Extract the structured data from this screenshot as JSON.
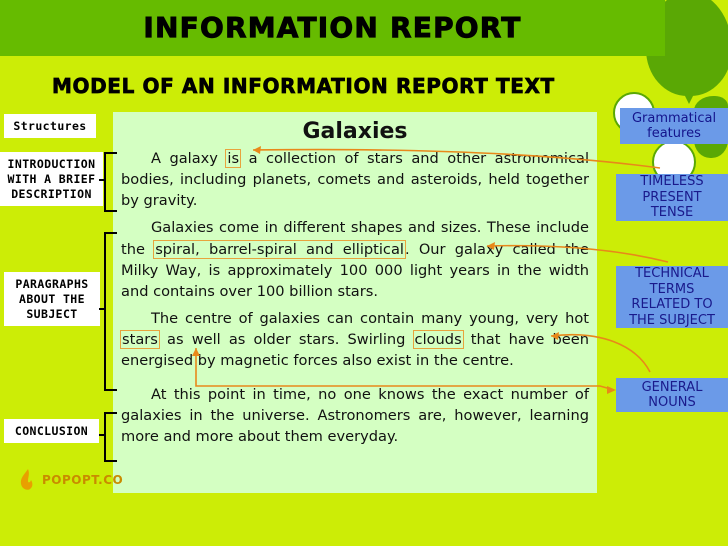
{
  "header": {
    "title": "INFORMATION REPORT",
    "subtitle": "MODEL OF AN INFORMATION REPORT TEXT",
    "band_color": "#66bb00",
    "background_color": "#cced06"
  },
  "content": {
    "title": "Galaxies",
    "card_color": "#d4ffc2",
    "paragraphs": [
      {
        "id": "p1",
        "segments": [
          {
            "text": "A galaxy ",
            "highlight": false
          },
          {
            "text": "is",
            "highlight": true
          },
          {
            "text": " a collection of stars and other astronomical bodies, including planets, comets and asteroids, held together by gravity.",
            "highlight": false
          }
        ]
      },
      {
        "id": "p2",
        "segments": [
          {
            "text": "Galaxies come in different shapes and sizes. These include the ",
            "highlight": false
          },
          {
            "text": "spiral, barrel-spiral and elliptical",
            "highlight": true
          },
          {
            "text": ". Our galaxy called the Milky Way, is approximately 100 000 light years in the width and contains over 100 billion stars.",
            "highlight": false
          }
        ]
      },
      {
        "id": "p3",
        "segments": [
          {
            "text": "The centre of galaxies can contain many young, very hot ",
            "highlight": false
          },
          {
            "text": "stars",
            "highlight": true
          },
          {
            "text": " as well as older stars. Swirling ",
            "highlight": false
          },
          {
            "text": "clouds",
            "highlight": true
          },
          {
            "text": " that have been energised by magnetic forces also exist in the centre.",
            "highlight": false
          }
        ]
      },
      {
        "id": "p4",
        "segments": [
          {
            "text": "At this point in time, no one knows the exact number of galaxies in the universe. Astronomers are, however, learning more and more about them everyday.",
            "highlight": false
          }
        ]
      }
    ]
  },
  "left_labels": {
    "structures": "Structures",
    "introduction": "INTRODUCTION\nWITH A BRIEF\nDESCRIPTION",
    "paragraphs": "PARAGRAPHS\nABOUT THE\nSUBJECT",
    "conclusion": "CONCLUSION"
  },
  "right_labels": {
    "grammatical": "Grammatical\nfeatures",
    "timeless": "TIMELESS\nPRESENT\nTENSE",
    "technical": "TECHNICAL\nTERMS\nRELATED TO\nTHE SUBJECT",
    "general": "GENERAL\nNOUNS",
    "box_color": "#6b9ae8",
    "text_color": "#14148c"
  },
  "decor": {
    "highlight_color": "#e8a33d",
    "connector_color": "#e8881a",
    "balloon_dark": "#5aa805",
    "balloon_white": "#ffffff"
  },
  "footer": {
    "logo_text": "POPOPT.CO"
  }
}
